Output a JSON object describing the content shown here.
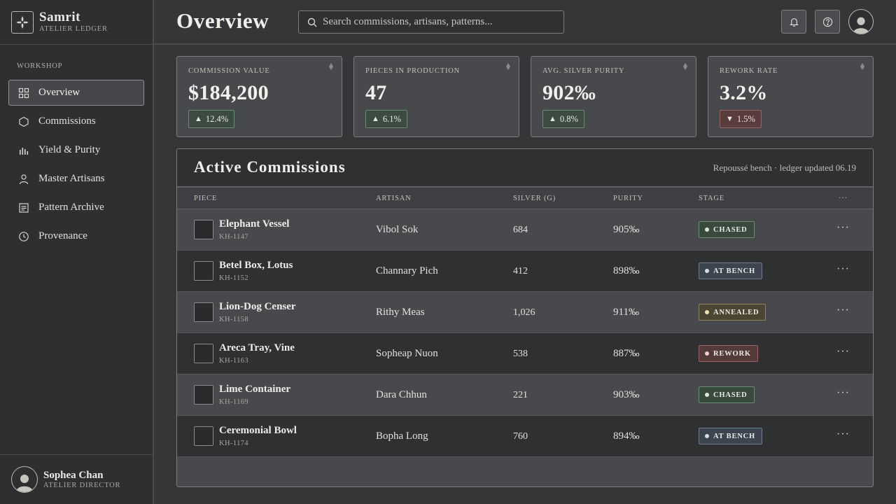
{
  "brand": {
    "name": "Samrit",
    "subtitle": "Atelier Ledger"
  },
  "sidebar": {
    "section_label": "Workshop",
    "items": [
      {
        "label": "Overview",
        "icon": "grid-icon",
        "active": true
      },
      {
        "label": "Commissions",
        "icon": "hexagon-icon",
        "active": false
      },
      {
        "label": "Yield & Purity",
        "icon": "bar-chart-icon",
        "active": false
      },
      {
        "label": "Master Artisans",
        "icon": "person-icon",
        "active": false
      },
      {
        "label": "Pattern Archive",
        "icon": "document-icon",
        "active": false
      },
      {
        "label": "Provenance",
        "icon": "clock-icon",
        "active": false
      }
    ],
    "user": {
      "name": "Sophea Chan",
      "role": "Atelier Director"
    }
  },
  "header": {
    "title": "Overview",
    "search_placeholder": "Search commissions, artisans, patterns..."
  },
  "kpis": [
    {
      "label": "Commission Value",
      "value": "$184,200",
      "delta": "12.4%",
      "direction": "up"
    },
    {
      "label": "Pieces in Production",
      "value": "47",
      "delta": "6.1%",
      "direction": "up"
    },
    {
      "label": "Avg. Silver Purity",
      "value": "902‰",
      "delta": "0.8%",
      "direction": "up"
    },
    {
      "label": "Rework Rate",
      "value": "3.2%",
      "delta": "1.5%",
      "direction": "down"
    }
  ],
  "commissions": {
    "title": "Active Commissions",
    "meta": "Repoussé bench · ledger updated 06.19",
    "columns": {
      "piece": "Piece",
      "artisan": "Artisan",
      "silver": "Silver (g)",
      "purity": "Purity",
      "stage": "Stage",
      "actions": "···"
    },
    "rows": [
      {
        "name": "Elephant Vessel",
        "id": "KH-1147",
        "artisan": "Vibol Sok",
        "silver": "684",
        "purity": "905‰",
        "stage": "Chased",
        "stage_kind": "chased"
      },
      {
        "name": "Betel Box, Lotus",
        "id": "KH-1152",
        "artisan": "Channary Pich",
        "silver": "412",
        "purity": "898‰",
        "stage": "At Bench",
        "stage_kind": "bench"
      },
      {
        "name": "Lion-Dog Censer",
        "id": "KH-1158",
        "artisan": "Rithy Meas",
        "silver": "1,026",
        "purity": "911‰",
        "stage": "Annealed",
        "stage_kind": "annealed"
      },
      {
        "name": "Areca Tray, Vine",
        "id": "KH-1163",
        "artisan": "Sopheap Nuon",
        "silver": "538",
        "purity": "887‰",
        "stage": "Rework",
        "stage_kind": "rework"
      },
      {
        "name": "Lime Container",
        "id": "KH-1169",
        "artisan": "Dara Chhun",
        "silver": "221",
        "purity": "903‰",
        "stage": "Chased",
        "stage_kind": "chased"
      },
      {
        "name": "Ceremonial Bowl",
        "id": "KH-1174",
        "artisan": "Bopha Long",
        "silver": "760",
        "purity": "894‰",
        "stage": "At Bench",
        "stage_kind": "bench"
      }
    ]
  },
  "colors": {
    "background": "#353638",
    "panel": "#48494d",
    "dark_row": "#2f3032",
    "up_badge": "#3d4c42",
    "down_badge": "#5a3c3c"
  }
}
